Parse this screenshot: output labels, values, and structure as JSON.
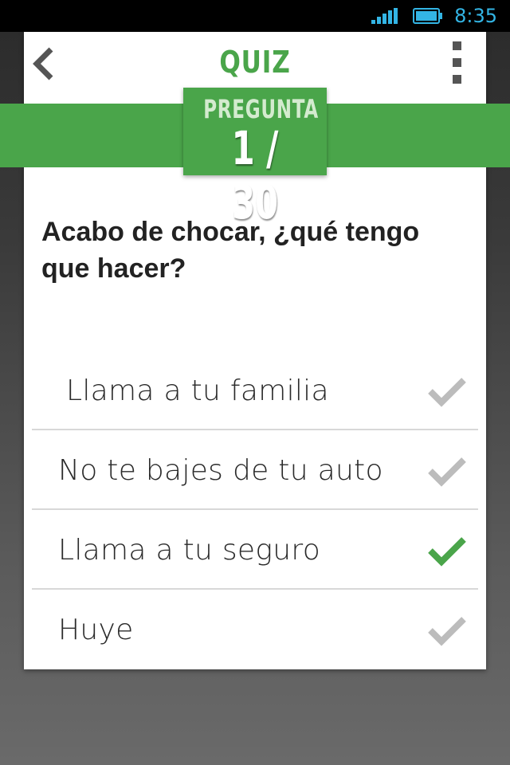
{
  "status_bar": {
    "time": "8:35",
    "icons": [
      "signal-icon",
      "battery-icon"
    ]
  },
  "header": {
    "title": "QUIZ",
    "icons": {
      "back": "chevron-left-icon",
      "menu": "more-vert-icon"
    }
  },
  "badge": {
    "label": "PREGUNTA",
    "counter": "1 / 30"
  },
  "question": {
    "text": "Acabo de chocar, ¿qué tengo que hacer?"
  },
  "answers": [
    {
      "text": "Llama a tu familia",
      "correct": false
    },
    {
      "text": "No te bajes de tu auto",
      "correct": false
    },
    {
      "text": "Llama a tu seguro",
      "correct": true
    },
    {
      "text": "Huye",
      "correct": false
    }
  ],
  "colors": {
    "accent": "#4aa54a",
    "status_accent": "#33b5e5",
    "check_default": "#bcbcbc",
    "check_correct": "#4aa54a"
  }
}
